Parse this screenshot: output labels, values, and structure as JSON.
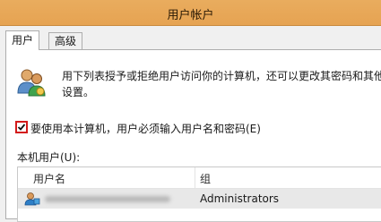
{
  "window": {
    "title": "用户帐户"
  },
  "tabs": [
    {
      "label": "用户",
      "active": true
    },
    {
      "label": "高级",
      "active": false
    }
  ],
  "description": {
    "line1": "用下列表授予或拒绝用户访问你的计算机，还可以更改其密码和其他",
    "line2": "设置。"
  },
  "require_password": {
    "label": "要使用本计算机，用户必须输入用户名和密码(E)",
    "checked": true
  },
  "users_list": {
    "label": "本机用户(U):",
    "columns": [
      "用户名",
      "组"
    ],
    "rows": [
      {
        "username": "",
        "group": "Administrators"
      }
    ]
  },
  "colors": {
    "titlebar": "#e9ac5e",
    "highlight_border": "#d31b1b"
  }
}
